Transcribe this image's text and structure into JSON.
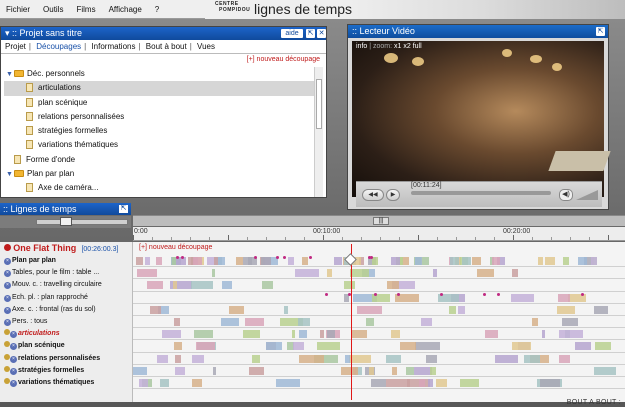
{
  "menu": {
    "items": [
      "Fichier",
      "Outils",
      "Films",
      "Affichage",
      "?"
    ]
  },
  "branding": {
    "logo_line1": "CENTRE",
    "logo_line2": "POMPIDOU",
    "title": "lignes de temps"
  },
  "project": {
    "title": "▾ :: Projet sans titre",
    "help_label": "aide",
    "tabs": [
      "Projet",
      "Découpages",
      "Informations",
      "Bout à bout",
      "Vues"
    ],
    "active_tab": "Découpages",
    "new_cut": "[+] nouveau découpage",
    "tree": [
      {
        "type": "folder",
        "label": "Déc. personnels",
        "expanded": true
      },
      {
        "type": "leaf",
        "label": "articulations",
        "selected": true
      },
      {
        "type": "leaf",
        "label": "plan scénique"
      },
      {
        "type": "leaf",
        "label": "relations personnalisées"
      },
      {
        "type": "leaf",
        "label": "stratégies formelles"
      },
      {
        "type": "leaf",
        "label": "variations thématiques"
      },
      {
        "type": "doc",
        "label": "Forme d'onde"
      },
      {
        "type": "folder",
        "label": "Plan par plan",
        "expanded": true
      },
      {
        "type": "leaf",
        "label": "Axe de caméra..."
      }
    ]
  },
  "video": {
    "title": ":: Lecteur Vidéo",
    "info": "info",
    "zoom_label": "zoom:",
    "zoom_options": "x1  x2  full",
    "timecode": "[00:11:24]"
  },
  "timelines": {
    "title": ":: Lignes de temps",
    "ruler_labels": [
      "0:00",
      "00:10:00",
      "00:20:00"
    ],
    "film_name": "One Flat Thing",
    "film_duration": "[00:26:00.3]",
    "new_cut": "[+] nouveau découpage",
    "tracks": [
      {
        "label": "Plan par plan",
        "style": "bold"
      },
      {
        "label": "Tables, pour le film : table ...",
        "style": "normal"
      },
      {
        "label": "Mouv. c. : travelling circulaire",
        "style": "normal"
      },
      {
        "label": "Ech. pl. : plan rapproché",
        "style": "normal"
      },
      {
        "label": "Axe. c. : frontal (ras du sol)",
        "style": "normal"
      },
      {
        "label": "Pers. : tous",
        "style": "normal"
      },
      {
        "label": "articulations",
        "style": "red"
      },
      {
        "label": "plan scénique",
        "style": "bold"
      },
      {
        "label": "relations personnalisées",
        "style": "bold"
      },
      {
        "label": "stratégies formelles",
        "style": "bold"
      },
      {
        "label": "variations thématiques",
        "style": "bold"
      }
    ],
    "footer": "BOUT A BOUT :"
  },
  "colors": {
    "title_blue": "#104a9c",
    "accent_red": "#c01b1b",
    "link_blue": "#1850a8",
    "playhead": "#e01818"
  }
}
